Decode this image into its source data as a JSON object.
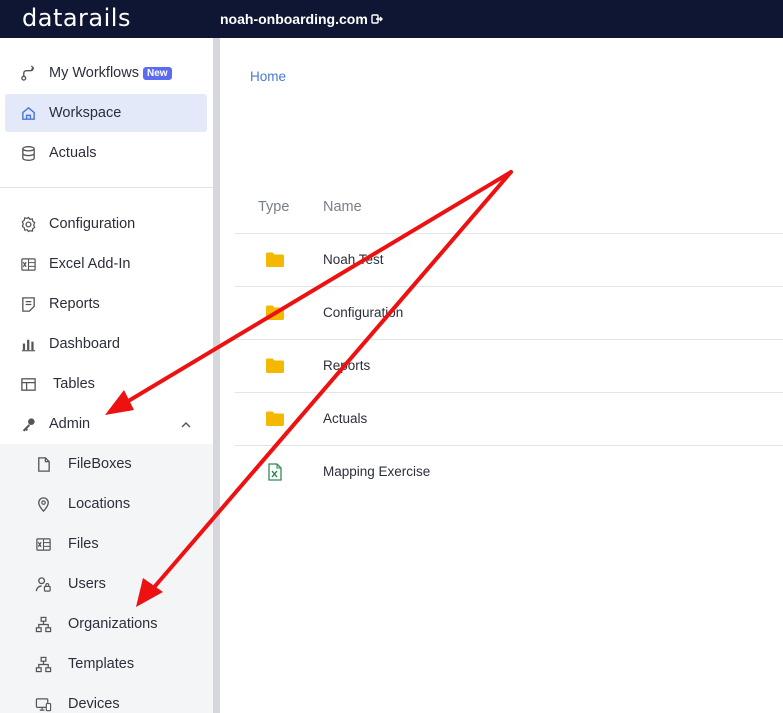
{
  "header": {
    "logo_text": "datarails",
    "tenant": "noah-onboarding.com"
  },
  "sidebar": {
    "items": [
      {
        "label": "My Workflows",
        "badge": "New",
        "icon": "workflow-icon"
      },
      {
        "label": "Workspace",
        "icon": "home-icon",
        "active": true
      },
      {
        "label": "Actuals",
        "icon": "database-icon"
      },
      {
        "label": "Configuration",
        "icon": "gear-icon"
      },
      {
        "label": "Excel Add-In",
        "icon": "excel-icon"
      },
      {
        "label": "Reports",
        "icon": "report-icon"
      },
      {
        "label": "Dashboard",
        "icon": "bar-chart-icon"
      },
      {
        "label": "Tables",
        "icon": "table-icon"
      },
      {
        "label": "Admin",
        "icon": "key-icon",
        "expanded": true
      }
    ],
    "admin_subitems": [
      {
        "label": "FileBoxes",
        "icon": "file-icon"
      },
      {
        "label": "Locations",
        "icon": "location-pin-icon"
      },
      {
        "label": "Files",
        "icon": "excel-file-icon"
      },
      {
        "label": "Users",
        "icon": "user-lock-icon"
      },
      {
        "label": "Organizations",
        "icon": "org-chart-icon"
      },
      {
        "label": "Templates",
        "icon": "org-chart-icon"
      },
      {
        "label": "Devices",
        "icon": "device-icon"
      }
    ]
  },
  "main": {
    "breadcrumb": "Home",
    "columns": {
      "type": "Type",
      "name": "Name"
    },
    "rows": [
      {
        "type": "folder",
        "name": "Noah Test"
      },
      {
        "type": "folder",
        "name": "Configuration"
      },
      {
        "type": "folder",
        "name": "Reports"
      },
      {
        "type": "folder",
        "name": "Actuals"
      },
      {
        "type": "excel",
        "name": "Mapping Exercise"
      }
    ]
  },
  "colors": {
    "topbar": "#0f1633",
    "accent": "#4a78d6",
    "folder": "#f5b800",
    "excel": "#2e8b57",
    "arrow": "#ee1111"
  }
}
